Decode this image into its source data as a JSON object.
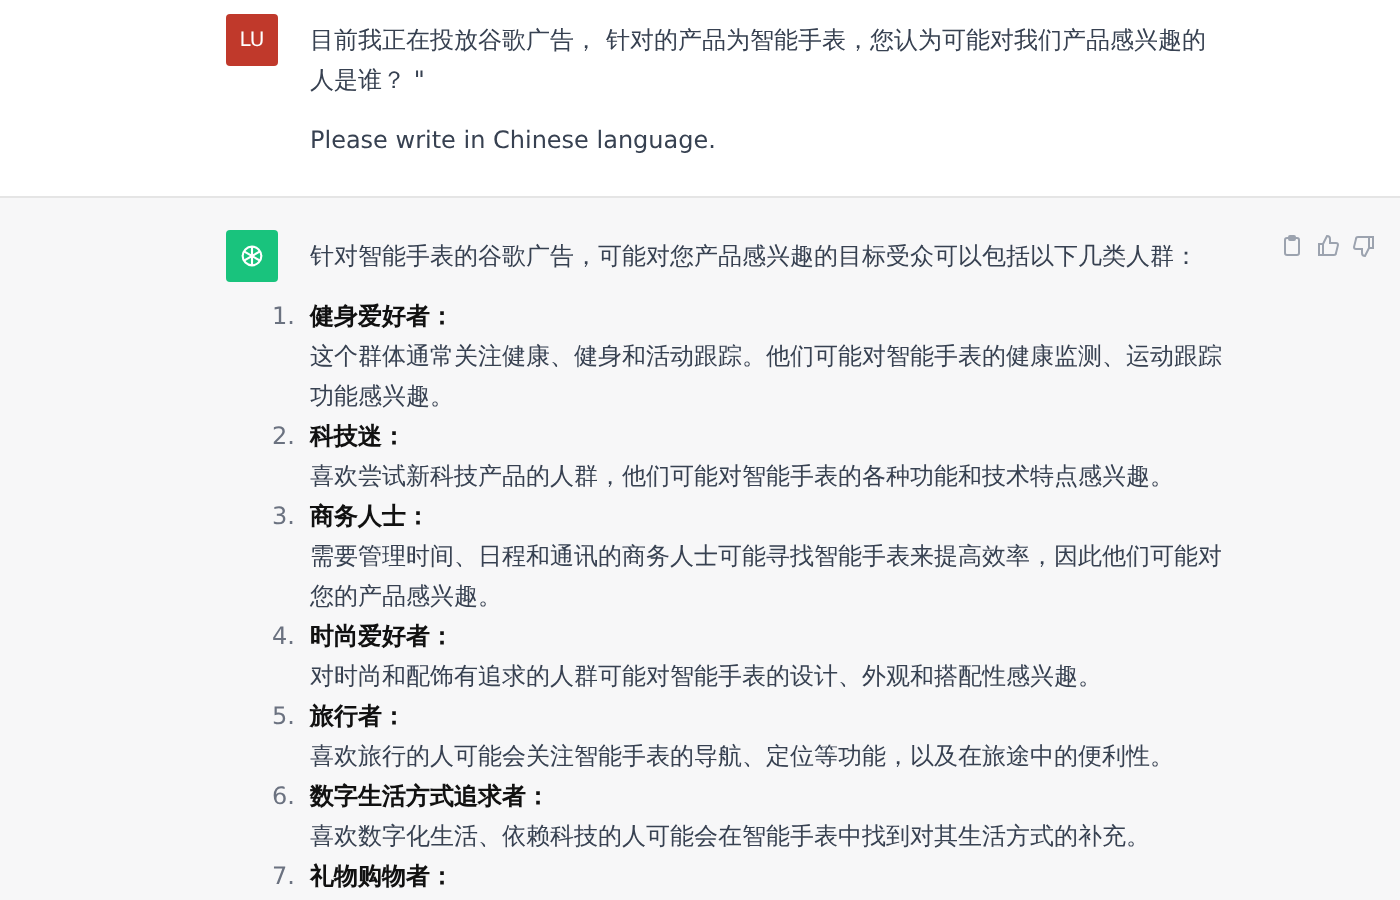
{
  "user_message": {
    "avatar": "LU",
    "paragraphs": [
      "目前我正在投放谷歌广告， 针对的产品为智能手表，您认为可能对我们产品感兴趣的人是谁？ \"",
      "Please write in Chinese language."
    ]
  },
  "assistant_message": {
    "intro": "针对智能手表的谷歌广告，可能对您产品感兴趣的目标受众可以包括以下几类人群：",
    "items": [
      {
        "number": "1.",
        "title": "健身爱好者：",
        "body": "这个群体通常关注健康、健身和活动跟踪。他们可能对智能手表的健康监测、运动跟踪功能感兴趣。"
      },
      {
        "number": "2.",
        "title": "科技迷：",
        "body": "喜欢尝试新科技产品的人群，他们可能对智能手表的各种功能和技术特点感兴趣。"
      },
      {
        "number": "3.",
        "title": "商务人士：",
        "body": "需要管理时间、日程和通讯的商务人士可能寻找智能手表来提高效率，因此他们可能对您的产品感兴趣。"
      },
      {
        "number": "4.",
        "title": "时尚爱好者：",
        "body": "对时尚和配饰有追求的人群可能对智能手表的设计、外观和搭配性感兴趣。"
      },
      {
        "number": "5.",
        "title": "旅行者：",
        "body": "喜欢旅行的人可能会关注智能手表的导航、定位等功能，以及在旅途中的便利性。"
      },
      {
        "number": "6.",
        "title": "数字生活方式追求者：",
        "body": "喜欢数字化生活、依赖科技的人可能会在智能手表中找到对其生活方式的补充。"
      },
      {
        "number": "7.",
        "title": "礼物购物者："
      }
    ]
  }
}
